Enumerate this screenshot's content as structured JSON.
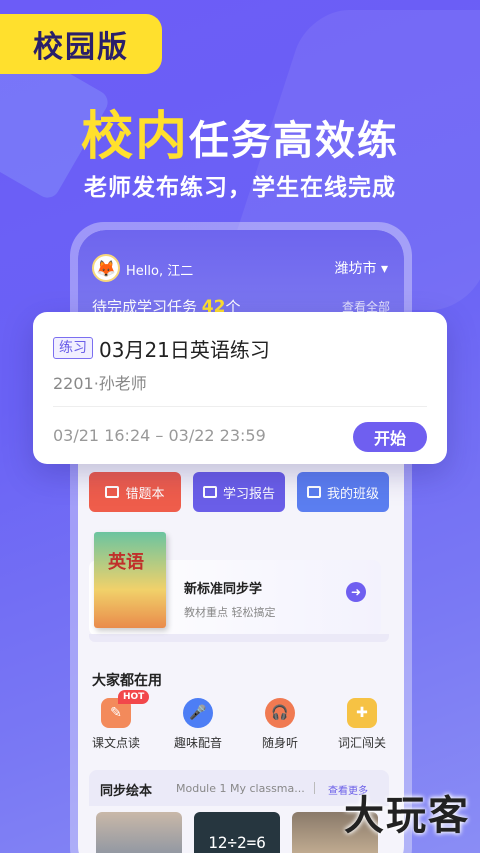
{
  "badge": {
    "label": "校园版"
  },
  "headline": {
    "highlight": "校内",
    "rest": "任务高效练"
  },
  "subline": "老师发布练习，学生在线完成",
  "phone": {
    "greeting": "Hello, 江二",
    "city": "潍坊市",
    "pending_prefix": "待完成学习任务",
    "pending_count": "42",
    "pending_suffix": "个",
    "view_all": "查看全部"
  },
  "task_card": {
    "tag": "练习",
    "title": "03月21日英语练习",
    "subtitle": "2201·孙老师",
    "time_range": "03/21 16:24 – 03/22 23:59",
    "start_label": "开始"
  },
  "quick_buttons": [
    {
      "label": "错题本",
      "color": "#ef5d4b"
    },
    {
      "label": "学习报告",
      "color": "#6a5ee8"
    },
    {
      "label": "我的班级",
      "color": "#5b7ef0"
    }
  ],
  "textbook": {
    "cover_text": "英语",
    "title": "新标准同步学",
    "subtitle": "教材重点 轻松搞定"
  },
  "popular": {
    "section_title": "大家都在用",
    "hot_badge": "HOT",
    "tools": [
      {
        "label": "课文点读",
        "icon": "book-read-icon"
      },
      {
        "label": "趣味配音",
        "icon": "microphone-icon"
      },
      {
        "label": "随身听",
        "icon": "headphones-icon"
      },
      {
        "label": "词汇闯关",
        "icon": "gamepad-icon"
      }
    ]
  },
  "picture_books": {
    "title": "同步绘本",
    "module": "Module 1 My classma...",
    "more": "查看更多",
    "board_text": "12÷2=6"
  },
  "watermark": "大玩客",
  "colors": {
    "accent": "#6f5ff0",
    "badge": "#ffe02d",
    "background": "#6c5cf7"
  }
}
